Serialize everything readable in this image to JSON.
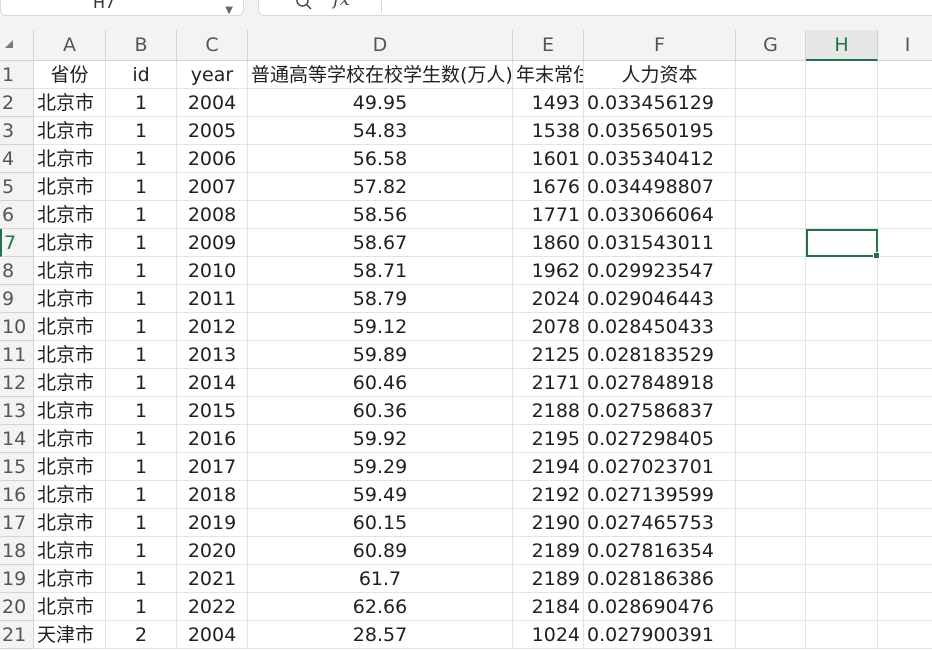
{
  "name_box": {
    "value": "H7"
  },
  "formula_bar": {
    "fx_label": "fx",
    "value": ""
  },
  "columns": [
    "A",
    "B",
    "C",
    "D",
    "E",
    "F",
    "G",
    "H",
    "I"
  ],
  "active_cell": {
    "column": "H",
    "row": 7
  },
  "header_row": {
    "row_number": "1",
    "cells": [
      "省份",
      "id",
      "year",
      "普通高等学校在校学生数(万人)",
      "年末常住人口",
      "人力资本"
    ]
  },
  "rows": [
    {
      "n": "2",
      "province": "北京市",
      "id": "1",
      "year": "2004",
      "students": "49.95",
      "population": "1493",
      "human_capital": "0.033456129"
    },
    {
      "n": "3",
      "province": "北京市",
      "id": "1",
      "year": "2005",
      "students": "54.83",
      "population": "1538",
      "human_capital": "0.035650195"
    },
    {
      "n": "4",
      "province": "北京市",
      "id": "1",
      "year": "2006",
      "students": "56.58",
      "population": "1601",
      "human_capital": "0.035340412"
    },
    {
      "n": "5",
      "province": "北京市",
      "id": "1",
      "year": "2007",
      "students": "57.82",
      "population": "1676",
      "human_capital": "0.034498807"
    },
    {
      "n": "6",
      "province": "北京市",
      "id": "1",
      "year": "2008",
      "students": "58.56",
      "population": "1771",
      "human_capital": "0.033066064"
    },
    {
      "n": "7",
      "province": "北京市",
      "id": "1",
      "year": "2009",
      "students": "58.67",
      "population": "1860",
      "human_capital": "0.031543011"
    },
    {
      "n": "8",
      "province": "北京市",
      "id": "1",
      "year": "2010",
      "students": "58.71",
      "population": "1962",
      "human_capital": "0.029923547"
    },
    {
      "n": "9",
      "province": "北京市",
      "id": "1",
      "year": "2011",
      "students": "58.79",
      "population": "2024",
      "human_capital": "0.029046443"
    },
    {
      "n": "10",
      "province": "北京市",
      "id": "1",
      "year": "2012",
      "students": "59.12",
      "population": "2078",
      "human_capital": "0.028450433"
    },
    {
      "n": "11",
      "province": "北京市",
      "id": "1",
      "year": "2013",
      "students": "59.89",
      "population": "2125",
      "human_capital": "0.028183529"
    },
    {
      "n": "12",
      "province": "北京市",
      "id": "1",
      "year": "2014",
      "students": "60.46",
      "population": "2171",
      "human_capital": "0.027848918"
    },
    {
      "n": "13",
      "province": "北京市",
      "id": "1",
      "year": "2015",
      "students": "60.36",
      "population": "2188",
      "human_capital": "0.027586837"
    },
    {
      "n": "14",
      "province": "北京市",
      "id": "1",
      "year": "2016",
      "students": "59.92",
      "population": "2195",
      "human_capital": "0.027298405"
    },
    {
      "n": "15",
      "province": "北京市",
      "id": "1",
      "year": "2017",
      "students": "59.29",
      "population": "2194",
      "human_capital": "0.027023701"
    },
    {
      "n": "16",
      "province": "北京市",
      "id": "1",
      "year": "2018",
      "students": "59.49",
      "population": "2192",
      "human_capital": "0.027139599"
    },
    {
      "n": "17",
      "province": "北京市",
      "id": "1",
      "year": "2019",
      "students": "60.15",
      "population": "2190",
      "human_capital": "0.027465753"
    },
    {
      "n": "18",
      "province": "北京市",
      "id": "1",
      "year": "2020",
      "students": "60.89",
      "population": "2189",
      "human_capital": "0.027816354"
    },
    {
      "n": "19",
      "province": "北京市",
      "id": "1",
      "year": "2021",
      "students": "61.7",
      "population": "2189",
      "human_capital": "0.028186386"
    },
    {
      "n": "20",
      "province": "北京市",
      "id": "1",
      "year": "2022",
      "students": "62.66",
      "population": "2184",
      "human_capital": "0.028690476"
    },
    {
      "n": "21",
      "province": "天津市",
      "id": "2",
      "year": "2004",
      "students": "28.57",
      "population": "1024",
      "human_capital": "0.027900391"
    }
  ]
}
